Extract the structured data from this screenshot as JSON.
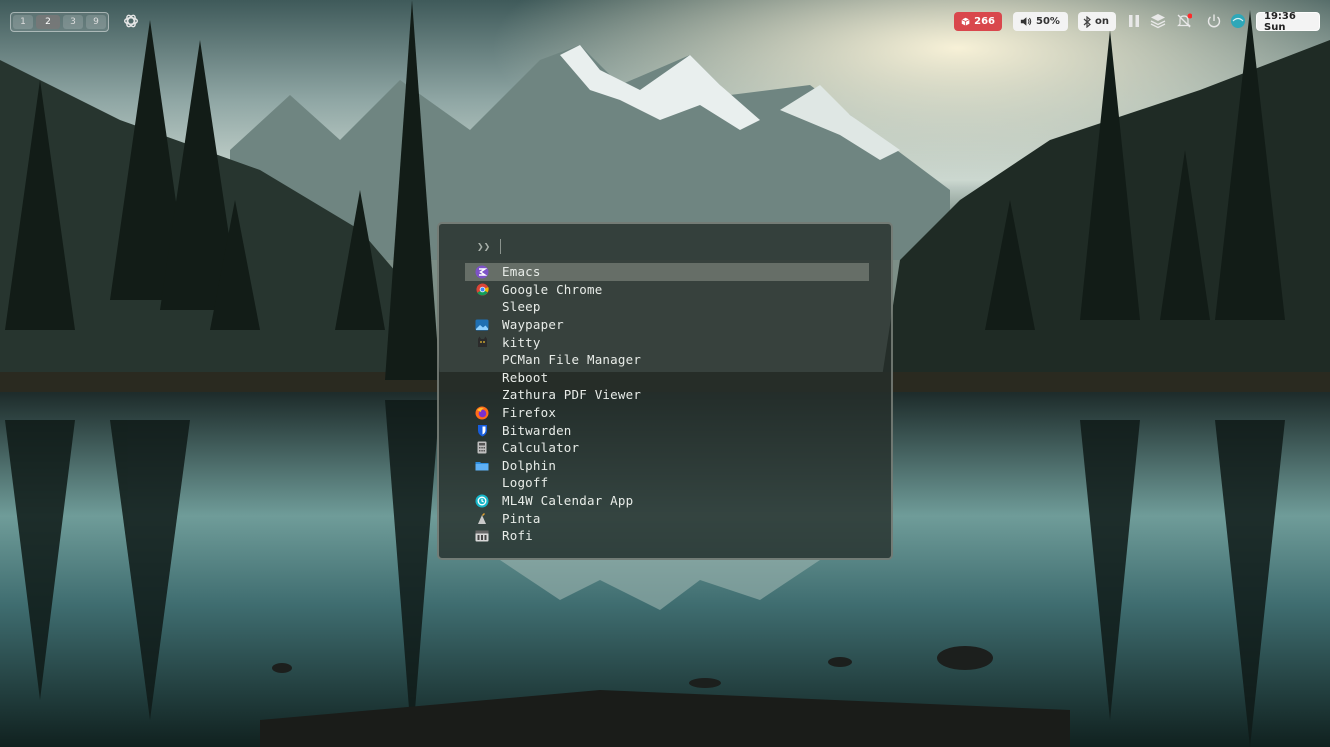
{
  "topbar": {
    "workspaces": [
      "1",
      "2",
      "3",
      "9"
    ],
    "active_workspace": "2",
    "updates_count": "266",
    "volume": "50%",
    "bluetooth_status": "on",
    "clock": "19:36 Sun",
    "colors": {
      "updates_chip": "#d9474c",
      "chip_bg": "#f3f3f3",
      "notification_dot": "#ff2a2a"
    },
    "icons": [
      "openai-icon",
      "package-icon",
      "speaker-icon",
      "bluetooth-icon",
      "pause-icon",
      "stack-icon",
      "notification-off-icon",
      "power-icon",
      "network-icon"
    ]
  },
  "launcher": {
    "prompt": "❯❯",
    "entries": [
      {
        "label": "Emacs",
        "icon": "emacs-icon",
        "selected": true
      },
      {
        "label": "Google Chrome",
        "icon": "chrome-icon"
      },
      {
        "label": "Sleep",
        "icon": ""
      },
      {
        "label": "Waypaper",
        "icon": "waypaper-icon"
      },
      {
        "label": "kitty",
        "icon": "kitty-icon"
      },
      {
        "label": "PCMan File Manager",
        "icon": ""
      },
      {
        "label": "Reboot",
        "icon": ""
      },
      {
        "label": "Zathura PDF Viewer",
        "icon": ""
      },
      {
        "label": "Firefox",
        "icon": "firefox-icon"
      },
      {
        "label": "Bitwarden",
        "icon": "bitwarden-icon"
      },
      {
        "label": "Calculator",
        "icon": "calculator-icon"
      },
      {
        "label": "Dolphin",
        "icon": "dolphin-icon"
      },
      {
        "label": "Logoff",
        "icon": ""
      },
      {
        "label": "ML4W Calendar App",
        "icon": "calendar-icon"
      },
      {
        "label": "Pinta",
        "icon": "pinta-icon"
      },
      {
        "label": "Rofi",
        "icon": "rofi-icon"
      }
    ]
  }
}
